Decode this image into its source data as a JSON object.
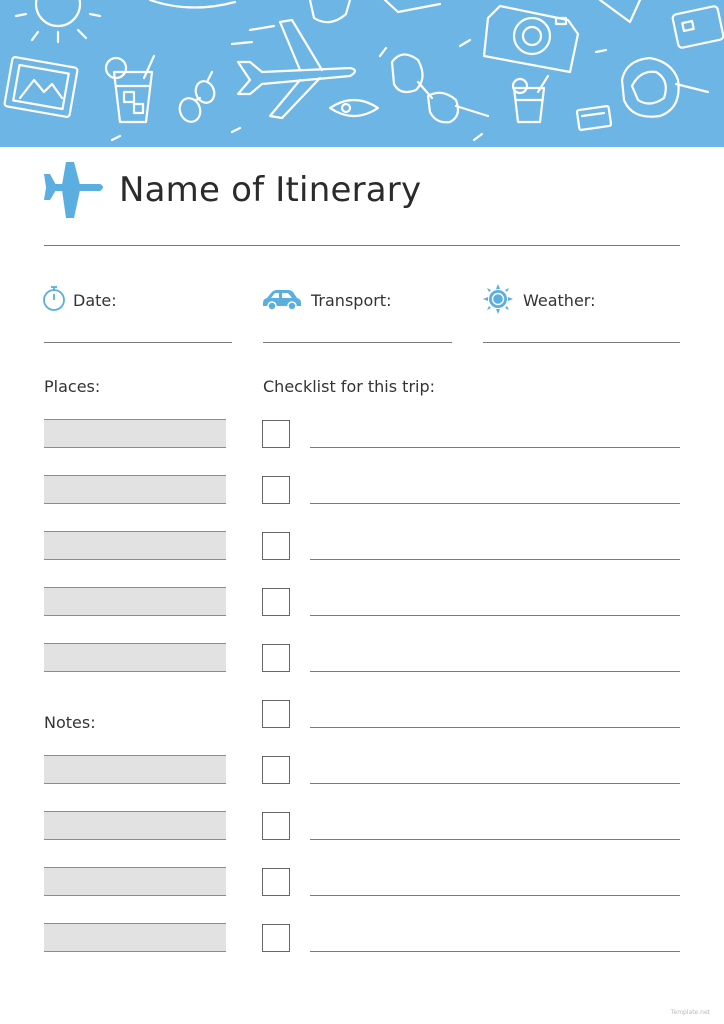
{
  "header": {
    "title": "Name of Itinerary",
    "banner_color": "#6db5e5",
    "icon": "airplane-icon"
  },
  "fields": [
    {
      "label": "Date:",
      "icon": "stopwatch-icon"
    },
    {
      "label": "Transport:",
      "icon": "car-icon"
    },
    {
      "label": "Weather:",
      "icon": "sun-icon"
    }
  ],
  "places": {
    "label": "Places:",
    "rows": 5
  },
  "notes": {
    "label": "Notes:",
    "rows": 4
  },
  "checklist": {
    "label": "Checklist for this trip:",
    "rows": 10
  },
  "accent_color": "#5aaee0",
  "watermark": "Template.net"
}
